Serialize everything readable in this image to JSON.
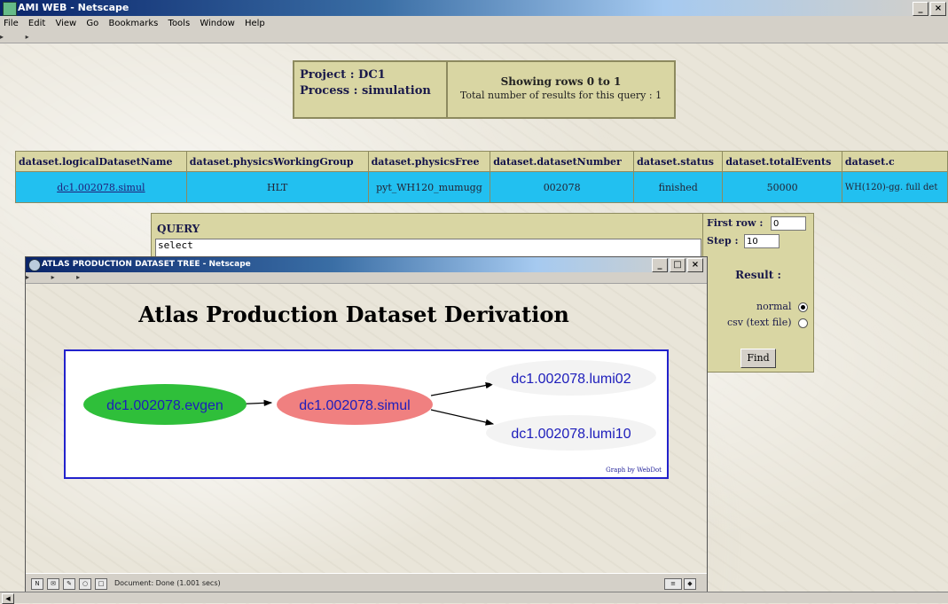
{
  "main_window": {
    "title": "AMI WEB - Netscape",
    "buttons": [
      "_",
      "×"
    ],
    "menu": [
      "File",
      "Edit",
      "View",
      "Go",
      "Bookmarks",
      "Tools",
      "Window",
      "Help"
    ]
  },
  "project_box": {
    "project": "Project : DC1",
    "process": "Process : simulation",
    "showing": "Showing rows 0 to 1",
    "total": "Total number of results for this query : 1"
  },
  "table": {
    "headers": [
      "dataset.logicalDatasetName",
      "dataset.physicsWorkingGroup",
      "dataset.physicsFree",
      "dataset.datasetNumber",
      "dataset.status",
      "dataset.totalEvents",
      "dataset.c"
    ],
    "rows": [
      [
        "dc1.002078.simul",
        "HLT",
        "pyt_WH120_mumugg",
        "002078",
        "finished",
        "50000",
        "WH(120)-gg. full det"
      ]
    ]
  },
  "query": {
    "label": "QUERY",
    "value": "select"
  },
  "controls": {
    "first_row_label": "First row :",
    "first_row_value": "0",
    "step_label": "Step :",
    "step_value": "10",
    "result_label": "Result :",
    "option_normal": "normal",
    "option_csv": "csv (text file)",
    "find_button": "Find"
  },
  "popup": {
    "title": "ATLAS PRODUCTION DATASET TREE - Netscape",
    "buttons": [
      "_",
      "□",
      "×"
    ],
    "heading": "Atlas Production Dataset Derivation",
    "graph": {
      "nodes": {
        "evgen": "dc1.002078.evgen",
        "simul": "dc1.002078.simul",
        "lumi02": "dc1.002078.lumi02",
        "lumi10": "dc1.002078.lumi10"
      },
      "colors": {
        "evgen": "#2fbf3a",
        "simul": "#f08080",
        "lumi": "#f3f3f3",
        "text": "#1d1dbb",
        "border": "#2222cc"
      }
    },
    "credit": "Graph by WebDot",
    "status": "Document: Done (1.001 secs)"
  }
}
